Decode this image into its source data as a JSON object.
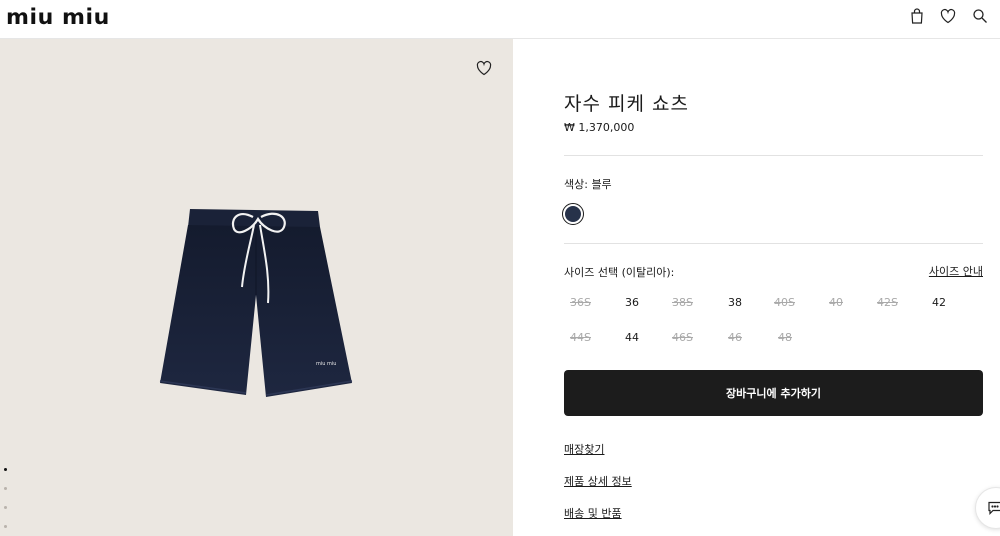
{
  "header": {
    "logo": "miu miu",
    "icons": [
      "shopping-bag-icon",
      "heart-icon",
      "search-icon"
    ]
  },
  "gallery": {
    "wishlist_icon": "heart-icon",
    "image_dots": 4,
    "active_dot": 0,
    "product_color": "#1e2740"
  },
  "product": {
    "title": "자수 피케 쇼츠",
    "price": "₩ 1,370,000",
    "color_label": "색상:  블루",
    "swatch_color": "#27324a",
    "size_label": "사이즈 선택 (이탈리아):",
    "size_guide": "사이즈 안내",
    "sizes": [
      {
        "label": "36S",
        "available": false
      },
      {
        "label": "36",
        "available": true
      },
      {
        "label": "38S",
        "available": false
      },
      {
        "label": "38",
        "available": true
      },
      {
        "label": "40S",
        "available": false
      },
      {
        "label": "40",
        "available": false
      },
      {
        "label": "42S",
        "available": false
      },
      {
        "label": "42",
        "available": true
      },
      {
        "label": "44S",
        "available": false
      },
      {
        "label": "44",
        "available": true
      },
      {
        "label": "46S",
        "available": false
      },
      {
        "label": "46",
        "available": false
      },
      {
        "label": "48",
        "available": false
      }
    ],
    "add_to_cart": "장바구니에 추가하기",
    "links": [
      "매장찾기",
      "제품 상세 정보",
      "배송 및 반품"
    ]
  },
  "chat_icon": "chat-bubble-icon"
}
